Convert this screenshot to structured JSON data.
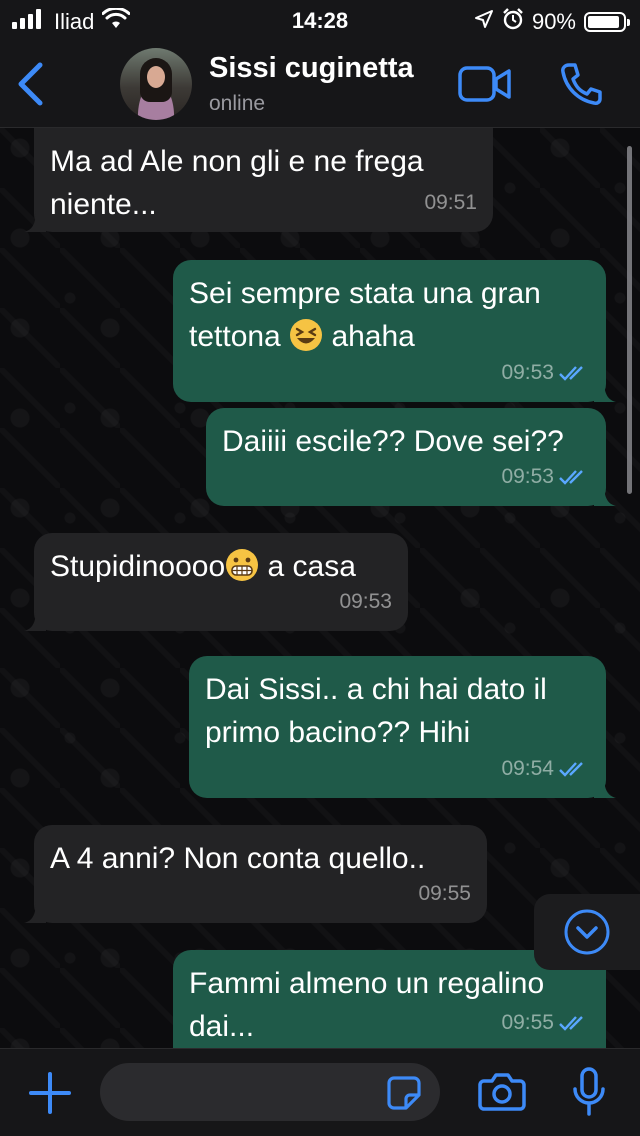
{
  "status_bar": {
    "carrier": "Iliad",
    "time": "14:28",
    "battery": "90%",
    "battery_level": 0.9
  },
  "header": {
    "contact_name": "Sissi cuginetta",
    "contact_status": "online"
  },
  "messages": [
    {
      "direction": "in",
      "text": "Ma ad Ale non gli e ne frega niente...",
      "time": "09:51"
    },
    {
      "direction": "out",
      "text_before": "Sei sempre stata una gran tettona",
      "emoji": "laughing-squinting-face",
      "text_after": "ahaha",
      "time": "09:53",
      "read": true
    },
    {
      "direction": "out",
      "text": "Daiiii escile?? Dove sei??",
      "time": "09:53",
      "read": true
    },
    {
      "direction": "in",
      "text_before": "Stupidinoooo",
      "emoji": "grimacing-face",
      "text_after": "a casa",
      "time": "09:53"
    },
    {
      "direction": "out",
      "text": "Dai Sissi.. a chi hai dato il primo bacino?? Hihi",
      "time": "09:54",
      "read": true
    },
    {
      "direction": "in",
      "text": "A 4 anni? Non conta quello..",
      "time": "09:55"
    },
    {
      "direction": "out",
      "text": "Fammi almeno un regalino dai...",
      "time": "09:55",
      "read": true
    }
  ],
  "colors": {
    "accent": "#3d8af7",
    "bubble_in": "#232325",
    "bubble_out": "#1f5a49",
    "read_ticks": "#5aa7ff"
  }
}
